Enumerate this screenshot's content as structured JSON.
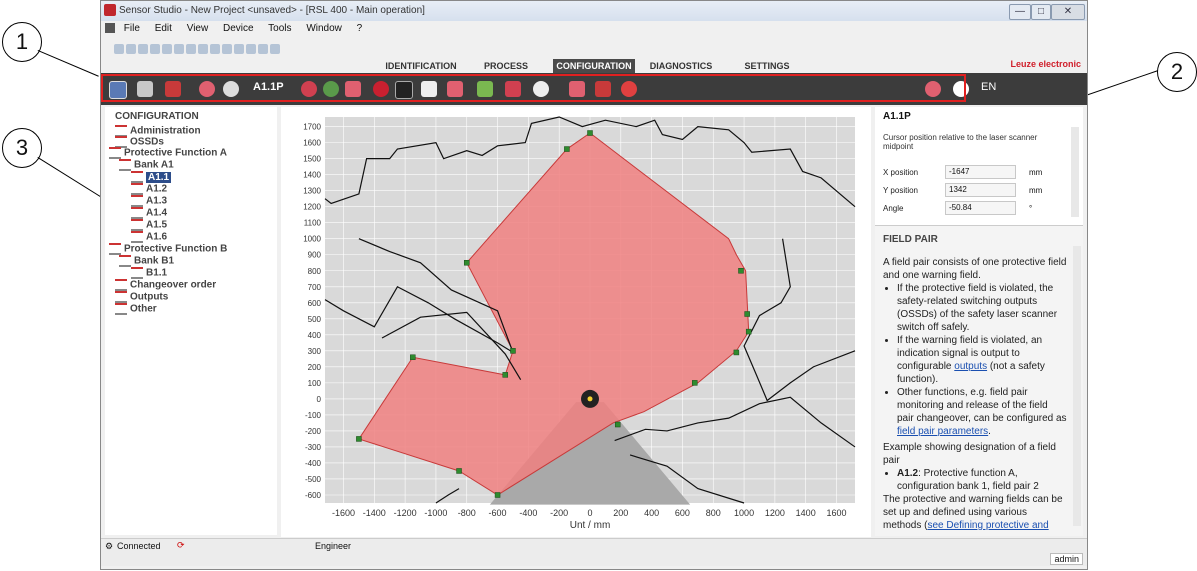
{
  "callouts": [
    "1",
    "2",
    "3"
  ],
  "window": {
    "title": "Sensor Studio - New Project  <unsaved>  - [RSL 400 - Main operation]",
    "buttons": [
      "—",
      "□",
      "✕"
    ]
  },
  "menu": [
    "File",
    "Edit",
    "View",
    "Device",
    "Tools",
    "Window",
    "?"
  ],
  "tabs": [
    "IDENTIFICATION",
    "PROCESS",
    "CONFIGURATION",
    "DIAGNOSTICS",
    "SETTINGS"
  ],
  "active_tab": "CONFIGURATION",
  "brand": "Leuze electronic",
  "toolbar": {
    "field_pair": "A1.1P",
    "language": "EN"
  },
  "tree": {
    "title": "CONFIGURATION",
    "items": [
      "Administration",
      "OSSDs",
      "Protective Function A",
      "Bank A1",
      "A1.1",
      "A1.2",
      "A1.3",
      "A1.4",
      "A1.5",
      "A1.6",
      "Protective Function B",
      "Bank B1",
      "B1.1",
      "Changeover order",
      "Outputs",
      "Other"
    ]
  },
  "cursor_panel": {
    "title": "A1.1P",
    "note": "Cursor position relative to the laser scanner midpoint",
    "x_label": "X position",
    "x_value": "-1647",
    "x_unit": "mm",
    "y_label": "Y position",
    "y_value": "1342",
    "y_unit": "mm",
    "angle_label": "Angle",
    "angle_value": "-50.84",
    "angle_unit": "°"
  },
  "help": {
    "title": "FIELD PAIR",
    "intro": "A field pair consists of one protective field and one warning field.",
    "bullet1": "If the protective field is violated, the safety-related switching outputs (OSSDs) of the safety laser scanner switch off safely.",
    "bullet2a": "If the warning field is violated, an indication signal is output to configurable ",
    "bullet2_link": "outputs",
    "bullet2b": " (not a safety function).",
    "bullet3a": "Other functions, e.g. field pair monitoring and release of the field pair changeover, can be configured as ",
    "bullet3_link": "field pair parameters",
    "bullet3b": ".",
    "example": "Example showing designation of a field pair",
    "ex_bold": "A1.2",
    "ex_rest": ": Protective function A, configuration bank 1, field pair 2",
    "outro_a": "The protective and warning fields can be set up and defined using various methods (",
    "outro_link": "see Defining protective and"
  },
  "status": {
    "connection": "Connected",
    "role": "Engineer",
    "user": "admin"
  },
  "plot": {
    "xlabel": "Unt / mm",
    "xticks": [
      -1600,
      -1400,
      -1200,
      -1000,
      -800,
      -600,
      -400,
      -200,
      0,
      200,
      400,
      600,
      800,
      1000,
      1200,
      1400,
      1600
    ],
    "yticks": [
      1700,
      1600,
      1500,
      1400,
      1300,
      1200,
      1100,
      1000,
      900,
      800,
      700,
      600,
      500,
      400,
      300,
      200,
      100,
      0,
      -100,
      -200,
      -300,
      -400,
      -500,
      -600
    ],
    "xlim": [
      -1720,
      1720
    ],
    "ylim": [
      -650,
      1760
    ],
    "colors": {
      "field": "#f08080",
      "field_edge": "#c83a3a",
      "bg": "#d9d9d9",
      "vertex": "#2e8b2e",
      "contour": "#111111",
      "shadow": "#a9a9a9"
    },
    "protective_field": [
      [
        0,
        1660
      ],
      [
        -150,
        1560
      ],
      [
        -800,
        850
      ],
      [
        -500,
        300
      ],
      [
        -550,
        150
      ],
      [
        -1150,
        260
      ],
      [
        -1500,
        -250
      ],
      [
        -850,
        -450
      ],
      [
        -600,
        -600
      ],
      [
        150,
        -150
      ],
      [
        350,
        -80
      ],
      [
        700,
        100
      ],
      [
        950,
        300
      ],
      [
        1030,
        420
      ],
      [
        1010,
        800
      ],
      [
        950,
        900
      ],
      [
        900,
        1000
      ],
      [
        0,
        1660
      ]
    ],
    "vertices": [
      [
        0,
        1660
      ],
      [
        -150,
        1560
      ],
      [
        -800,
        850
      ],
      [
        -500,
        300
      ],
      [
        -550,
        150
      ],
      [
        -1150,
        260
      ],
      [
        -1500,
        -250
      ],
      [
        -850,
        -450
      ],
      [
        -600,
        -600
      ],
      [
        180,
        -160
      ],
      [
        680,
        100
      ],
      [
        950,
        290
      ],
      [
        1030,
        420
      ],
      [
        1020,
        530
      ],
      [
        980,
        800
      ]
    ],
    "contour": [
      [
        -1720,
        1250
      ],
      [
        -1680,
        1220
      ],
      [
        -1500,
        1280
      ],
      [
        -1450,
        1500
      ],
      [
        -1300,
        1500
      ],
      [
        -1250,
        1560
      ],
      [
        -1000,
        1600
      ],
      [
        -950,
        1500
      ],
      [
        -800,
        1550
      ],
      [
        -700,
        1520
      ],
      [
        -600,
        1580
      ],
      [
        -420,
        1600
      ],
      [
        -380,
        1720
      ],
      [
        -200,
        1760
      ],
      [
        -50,
        1700
      ],
      [
        100,
        1740
      ],
      [
        300,
        1700
      ],
      [
        420,
        1740
      ],
      [
        470,
        1650
      ],
      [
        600,
        1620
      ],
      [
        700,
        1700
      ],
      [
        900,
        1680
      ],
      [
        1000,
        1600
      ],
      [
        1050,
        1540
      ],
      [
        1300,
        1560
      ],
      [
        1380,
        1420
      ],
      [
        1500,
        1380
      ],
      [
        1720,
        1200
      ]
    ],
    "contour2": [
      [
        -1720,
        620
      ],
      [
        -1600,
        550
      ],
      [
        -1400,
        450
      ],
      [
        -1250,
        700
      ],
      [
        -1050,
        600
      ],
      [
        -880,
        500
      ],
      [
        -600,
        350
      ],
      [
        -500,
        290
      ],
      [
        -600,
        550
      ],
      [
        -900,
        680
      ],
      [
        -1100,
        850
      ],
      [
        -1300,
        920
      ],
      [
        -1500,
        1000
      ]
    ],
    "contour3": [
      [
        -1350,
        380
      ],
      [
        -1100,
        510
      ],
      [
        -800,
        540
      ],
      [
        -550,
        280
      ],
      [
        -450,
        120
      ]
    ],
    "contour4": [
      [
        1720,
        300
      ],
      [
        1450,
        200
      ],
      [
        1300,
        100
      ],
      [
        1150,
        -10
      ],
      [
        1080,
        150
      ],
      [
        1000,
        330
      ],
      [
        1100,
        520
      ],
      [
        1240,
        600
      ],
      [
        1300,
        700
      ],
      [
        1250,
        1000
      ]
    ],
    "contour5": [
      [
        160,
        -260
      ],
      [
        360,
        -190
      ],
      [
        500,
        -200
      ],
      [
        700,
        -150
      ],
      [
        900,
        -120
      ],
      [
        1100,
        -30
      ],
      [
        1300,
        10
      ],
      [
        1500,
        -150
      ],
      [
        1720,
        -300
      ]
    ],
    "contour6": [
      [
        260,
        -350
      ],
      [
        500,
        -420
      ],
      [
        700,
        -560
      ],
      [
        1000,
        -650
      ]
    ],
    "contour7": [
      [
        -1000,
        -650
      ],
      [
        -920,
        -600
      ],
      [
        -850,
        -560
      ]
    ]
  }
}
